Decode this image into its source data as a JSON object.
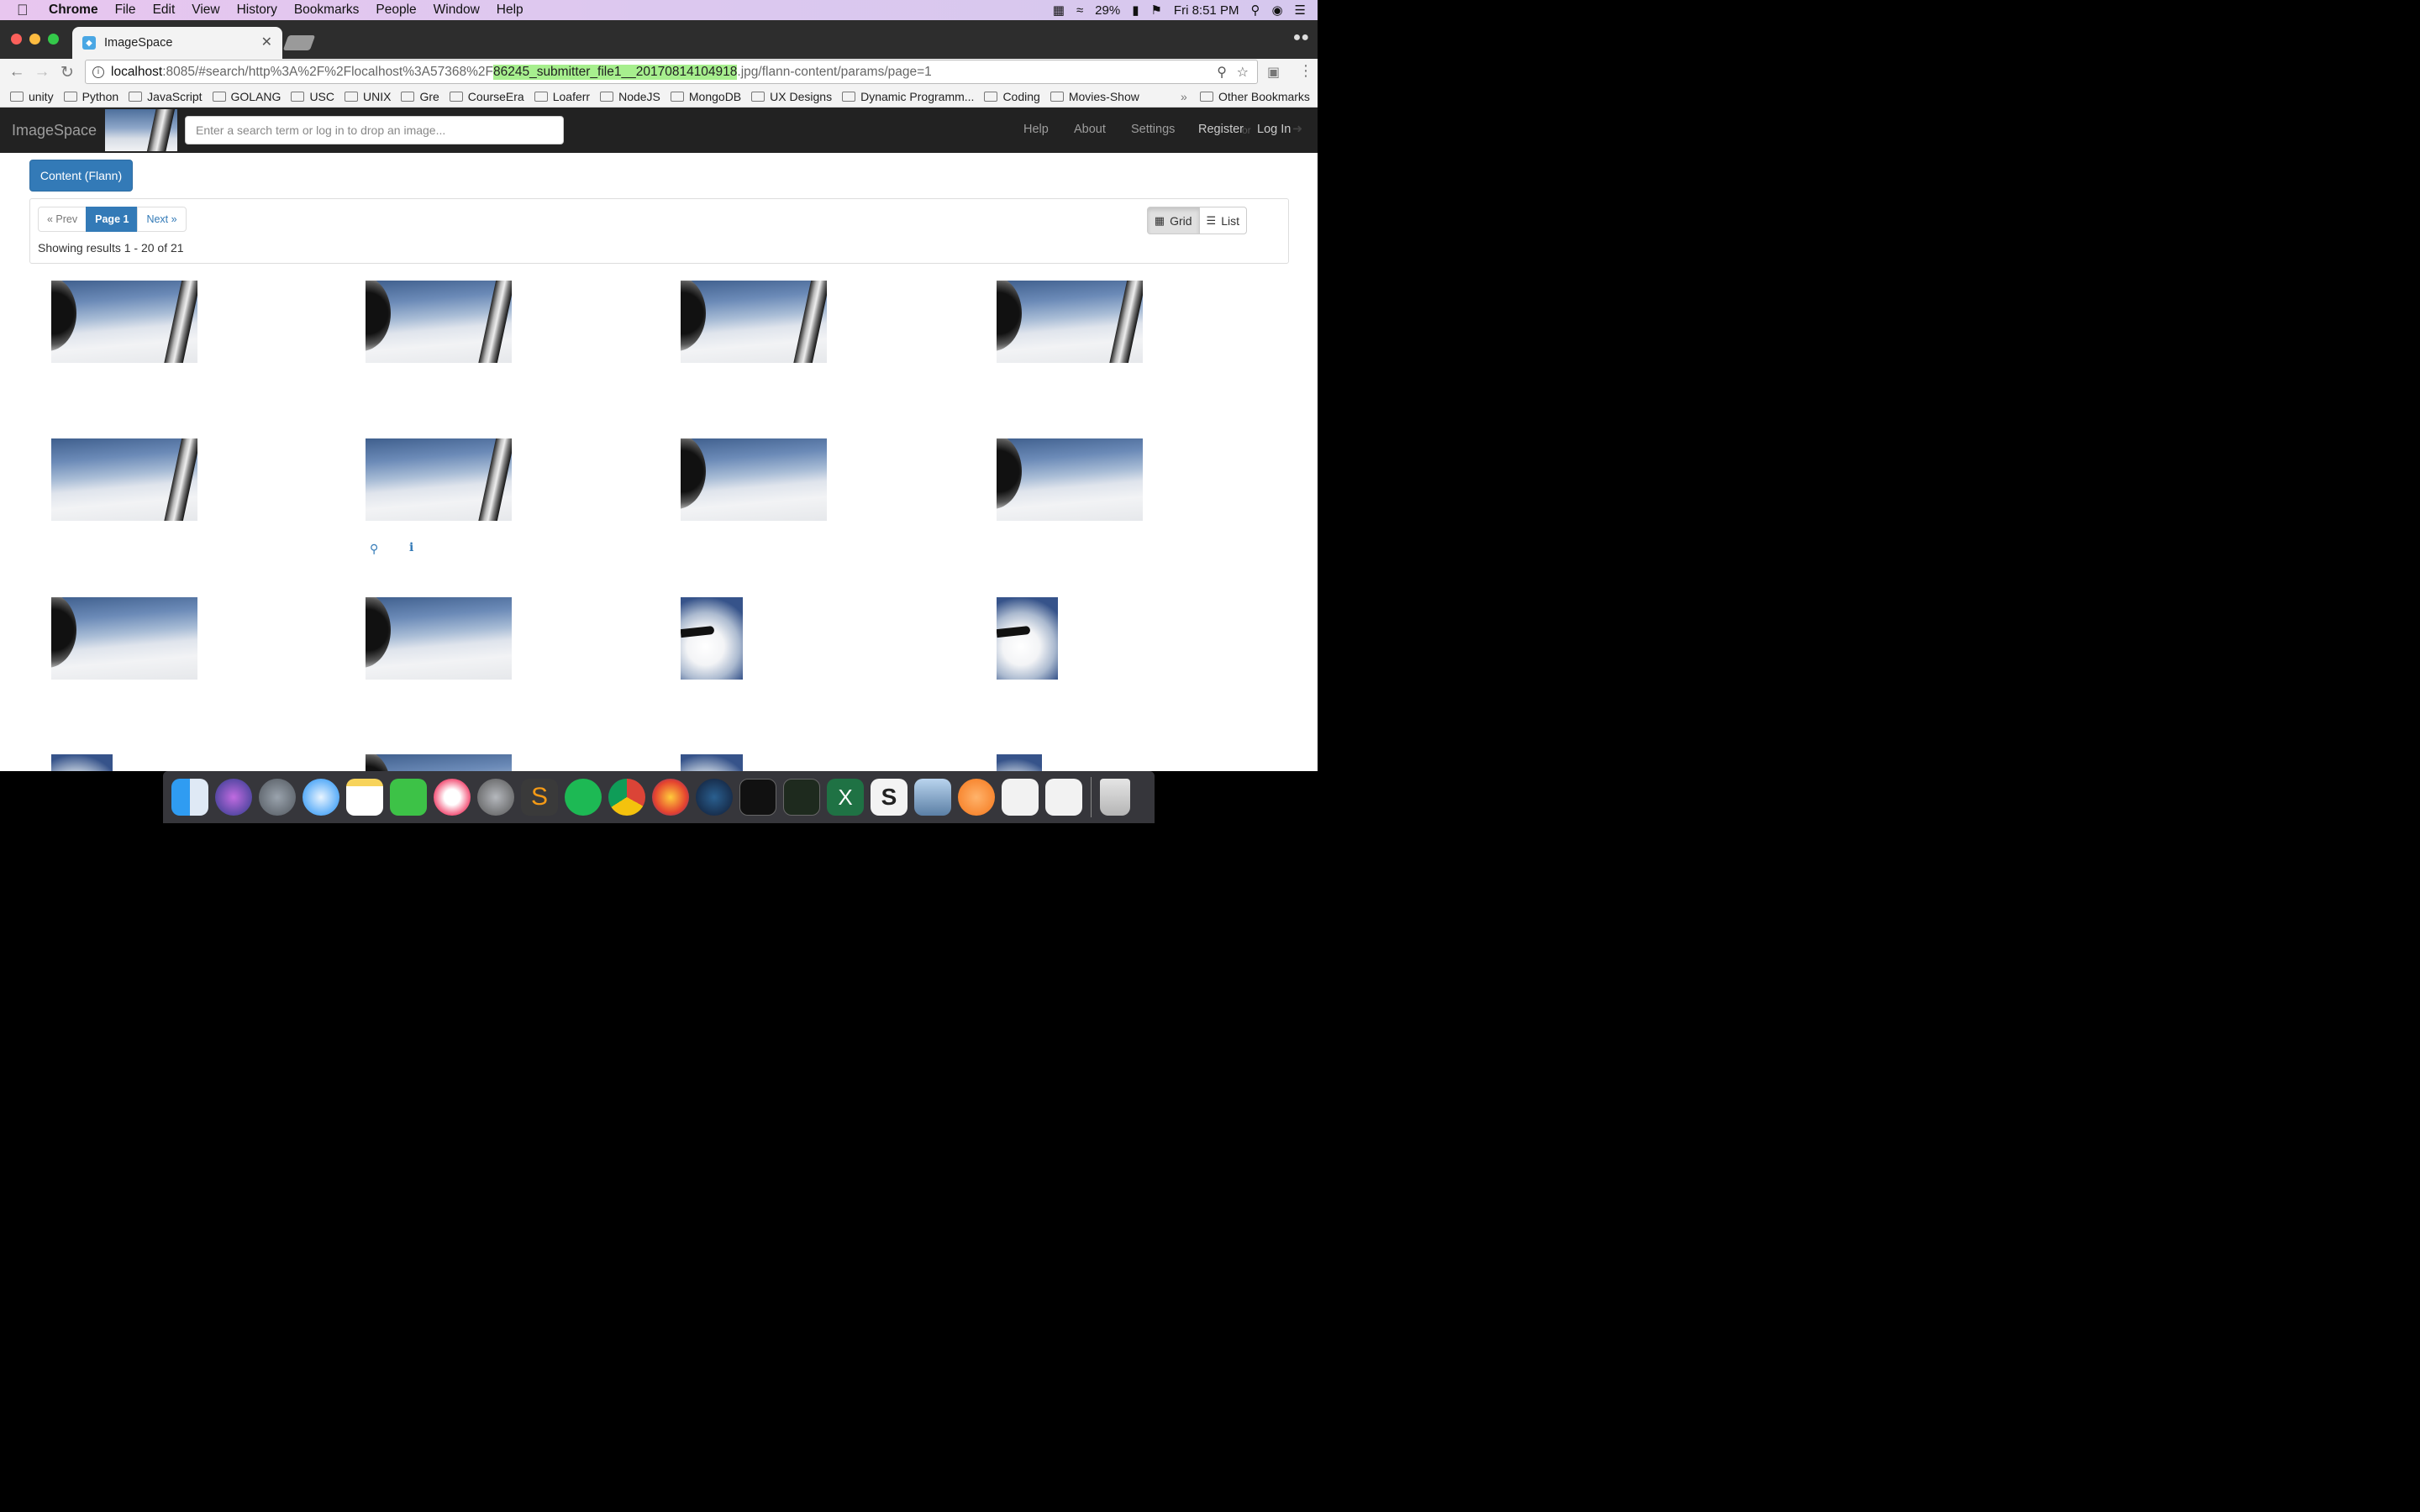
{
  "menubar": {
    "app": "Chrome",
    "items": [
      "File",
      "Edit",
      "View",
      "History",
      "Bookmarks",
      "People",
      "Window",
      "Help"
    ],
    "battery": "29%",
    "clock": "Fri 8:51 PM"
  },
  "tab": {
    "title": "ImageSpace"
  },
  "address": {
    "host": "localhost",
    "path_before": ":8085/#search/http%3A%2F%2Flocalhost%3A57368%2F",
    "highlight": "86245_submitter_file1__20170814104918",
    "path_after": ".jpg/flann-content/params/page=1"
  },
  "bookmarks": {
    "items": [
      "unity",
      "Python",
      "JavaScript",
      "GOLANG",
      "USC",
      "UNIX",
      "Gre",
      "CourseEra",
      "Loaferr",
      "NodeJS",
      "MongoDB",
      "UX Designs",
      "Dynamic Programm...",
      "Coding",
      "Movies-Show"
    ],
    "overflow": "»",
    "other": "Other Bookmarks"
  },
  "navbar": {
    "brand": "ImageSpace",
    "search_placeholder": "Enter a search term or log in to drop an image...",
    "help": "Help",
    "about": "About",
    "settings": "Settings",
    "register": "Register",
    "or": "or",
    "login": "Log In"
  },
  "content": {
    "mode_button": "Content (Flann)",
    "pager": {
      "prev": "« Prev",
      "current": "Page 1",
      "next": "Next »"
    },
    "results": "Showing results 1 - 20 of 21",
    "view": {
      "grid": "Grid",
      "list": "List",
      "selected": "Grid"
    }
  },
  "icons": {
    "search": "search-icon",
    "info": "info-icon",
    "grid": "grid-icon",
    "list": "list-icon"
  }
}
